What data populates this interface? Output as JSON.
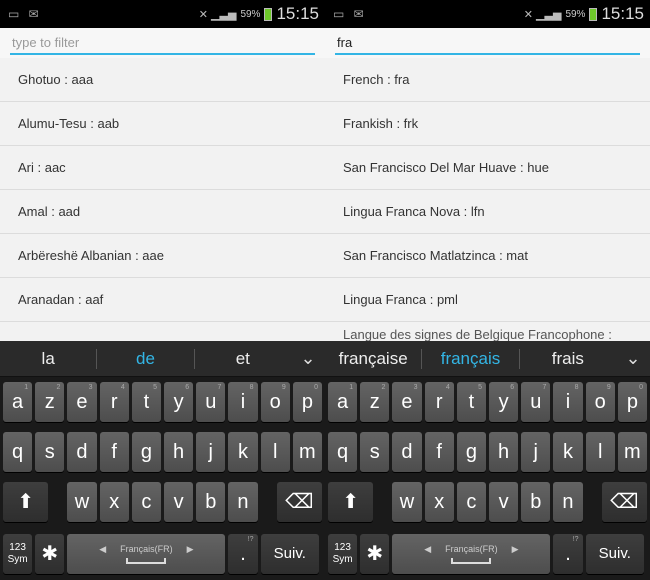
{
  "status_bar": {
    "battery": "59%",
    "time": "15:15",
    "notif_icons": "▭ ✉",
    "signal_icons": "✕ ▁▃▅"
  },
  "left": {
    "filter": {
      "value": "",
      "placeholder": "type to filter"
    },
    "items": [
      "Ghotuo : aaa",
      "Alumu-Tesu : aab",
      "Ari : aac",
      "Amal : aad",
      "Arbëreshë Albanian : aae",
      "Aranadan : aaf"
    ],
    "partial_item": "",
    "suggestions": [
      "la",
      "de",
      "et"
    ],
    "selected_suggestion": 1
  },
  "right": {
    "filter": {
      "value": "fra",
      "placeholder": ""
    },
    "items": [
      "French : fra",
      "Frankish : frk",
      "San Francisco Del Mar Huave : hue",
      "Lingua Franca Nova : lfn",
      "San Francisco Matlatzinca : mat",
      "Lingua Franca : pml"
    ],
    "partial_item": "Langue des signes de Belgique Francophone :",
    "suggestions": [
      "française",
      "français",
      "frais"
    ],
    "selected_suggestion": 1
  },
  "keyboard": {
    "row1": [
      {
        "k": "a",
        "h": "1"
      },
      {
        "k": "z",
        "h": "2"
      },
      {
        "k": "e",
        "h": "3"
      },
      {
        "k": "r",
        "h": "4"
      },
      {
        "k": "t",
        "h": "5"
      },
      {
        "k": "y",
        "h": "6"
      },
      {
        "k": "u",
        "h": "7"
      },
      {
        "k": "i",
        "h": "8"
      },
      {
        "k": "o",
        "h": "9"
      },
      {
        "k": "p",
        "h": "0"
      }
    ],
    "row2": [
      "q",
      "s",
      "d",
      "f",
      "g",
      "h",
      "j",
      "k",
      "l",
      "m"
    ],
    "row3": [
      "w",
      "x",
      "c",
      "v",
      "b",
      "n"
    ],
    "shift": "⬆",
    "backspace": "⌫",
    "sym": "123\nSym",
    "settings": "✱",
    "space_label": "Français(FR)",
    "space_arrow_left": "◀",
    "space_arrow_right": "▶",
    "period": ".",
    "period_hint": "!?",
    "enter": "Suiv.",
    "suggest_more": "⌄",
    "accent": "#33b5e5"
  }
}
